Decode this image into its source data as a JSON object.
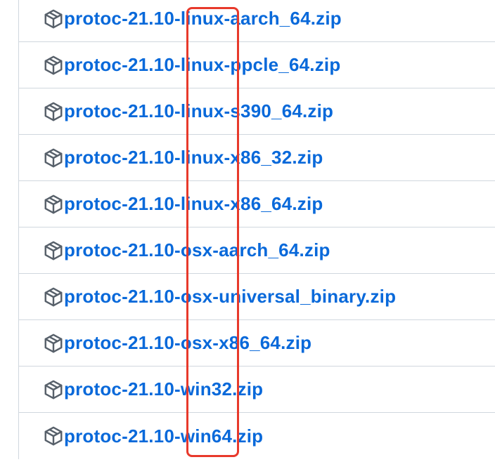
{
  "assets": [
    {
      "name": "protoc-21.10-linux-aarch_64.zip",
      "icon": "package-icon"
    },
    {
      "name": "protoc-21.10-linux-ppcle_64.zip",
      "icon": "package-icon"
    },
    {
      "name": "protoc-21.10-linux-s390_64.zip",
      "icon": "package-icon"
    },
    {
      "name": "protoc-21.10-linux-x86_32.zip",
      "icon": "package-icon"
    },
    {
      "name": "protoc-21.10-linux-x86_64.zip",
      "icon": "package-icon"
    },
    {
      "name": "protoc-21.10-osx-aarch_64.zip",
      "icon": "package-icon"
    },
    {
      "name": "protoc-21.10-osx-universal_binary.zip",
      "icon": "package-icon"
    },
    {
      "name": "protoc-21.10-osx-x86_64.zip",
      "icon": "package-icon"
    },
    {
      "name": "protoc-21.10-win32.zip",
      "icon": "package-icon"
    },
    {
      "name": "protoc-21.10-win64.zip",
      "icon": "package-icon"
    }
  ],
  "colors": {
    "link": "#0969da",
    "border": "#d0d7de",
    "icon": "#57606a",
    "highlight": "#e8392b"
  }
}
